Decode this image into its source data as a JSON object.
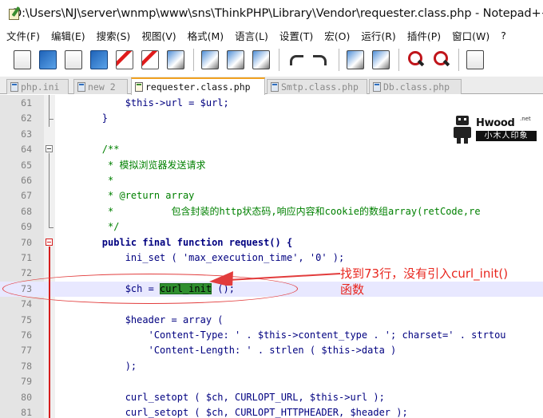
{
  "window": {
    "title": "D:\\Users\\NJ\\server\\wnmp\\www\\sns\\ThinkPHP\\Library\\Vendor\\requester.class.php - Notepad++"
  },
  "menu": [
    "文件(F)",
    "编辑(E)",
    "搜索(S)",
    "视图(V)",
    "格式(M)",
    "语言(L)",
    "设置(T)",
    "宏(O)",
    "运行(R)",
    "插件(P)",
    "窗口(W)",
    "?"
  ],
  "toolbar": {
    "icons": [
      "new-file-icon",
      "open-file-icon",
      "save-icon",
      "save-all-icon",
      "close-icon",
      "close-all-icon",
      "print-icon",
      "cut-icon",
      "copy-icon",
      "paste-icon",
      "undo-icon",
      "redo-icon",
      "find-icon",
      "replace-icon",
      "zoom-in-icon",
      "zoom-out-icon",
      "sync-vertical-icon"
    ]
  },
  "tabs": [
    {
      "label": "php.ini",
      "active": false
    },
    {
      "label": "new  2",
      "active": false
    },
    {
      "label": "requester.class.php",
      "active": true
    },
    {
      "label": "Smtp.class.php",
      "active": false
    },
    {
      "label": "Db.class.php",
      "active": false
    }
  ],
  "editor": {
    "lines": [
      {
        "num": "61",
        "text": "            $this->url = $url;"
      },
      {
        "num": "62",
        "text": "        }"
      },
      {
        "num": "63",
        "text": ""
      },
      {
        "num": "64",
        "text": "        /**"
      },
      {
        "num": "65",
        "text": "         * 模拟浏览器发送请求"
      },
      {
        "num": "66",
        "text": "         *"
      },
      {
        "num": "67",
        "text": "         * @return array"
      },
      {
        "num": "68",
        "text": "         *          包含封装的http状态码,响应内容和cookie的数组array(retCode,re"
      },
      {
        "num": "69",
        "text": "         */"
      },
      {
        "num": "70",
        "text": "        public final function request() {"
      },
      {
        "num": "71",
        "text": "            ini_set ( 'max_execution_time', '0' );"
      },
      {
        "num": "72",
        "text": ""
      },
      {
        "num": "73",
        "text": "            $ch = curl_init ();"
      },
      {
        "num": "74",
        "text": ""
      },
      {
        "num": "75",
        "text": "            $header = array ("
      },
      {
        "num": "76",
        "text": "                'Content-Type: ' . $this->content_type . '; charset=' . strtou"
      },
      {
        "num": "77",
        "text": "                'Content-Length: ' . strlen ( $this->data )"
      },
      {
        "num": "78",
        "text": "            );"
      },
      {
        "num": "79",
        "text": ""
      },
      {
        "num": "80",
        "text": "            curl_setopt ( $ch, CURLOPT_URL, $this->url );"
      },
      {
        "num": "81",
        "text": "            curl_setopt ( $ch, CURLOPT_HTTPHEADER, $header );"
      }
    ],
    "current_line": "73",
    "highlighted_token": "curl_init"
  },
  "annotation": {
    "line1": "找到73行，没有引入curl_init()",
    "line2": "函数",
    "color": "#e8261e"
  },
  "watermark": {
    "brand": "Hwood",
    "net": ".net",
    "subtitle": "小木人印象"
  }
}
